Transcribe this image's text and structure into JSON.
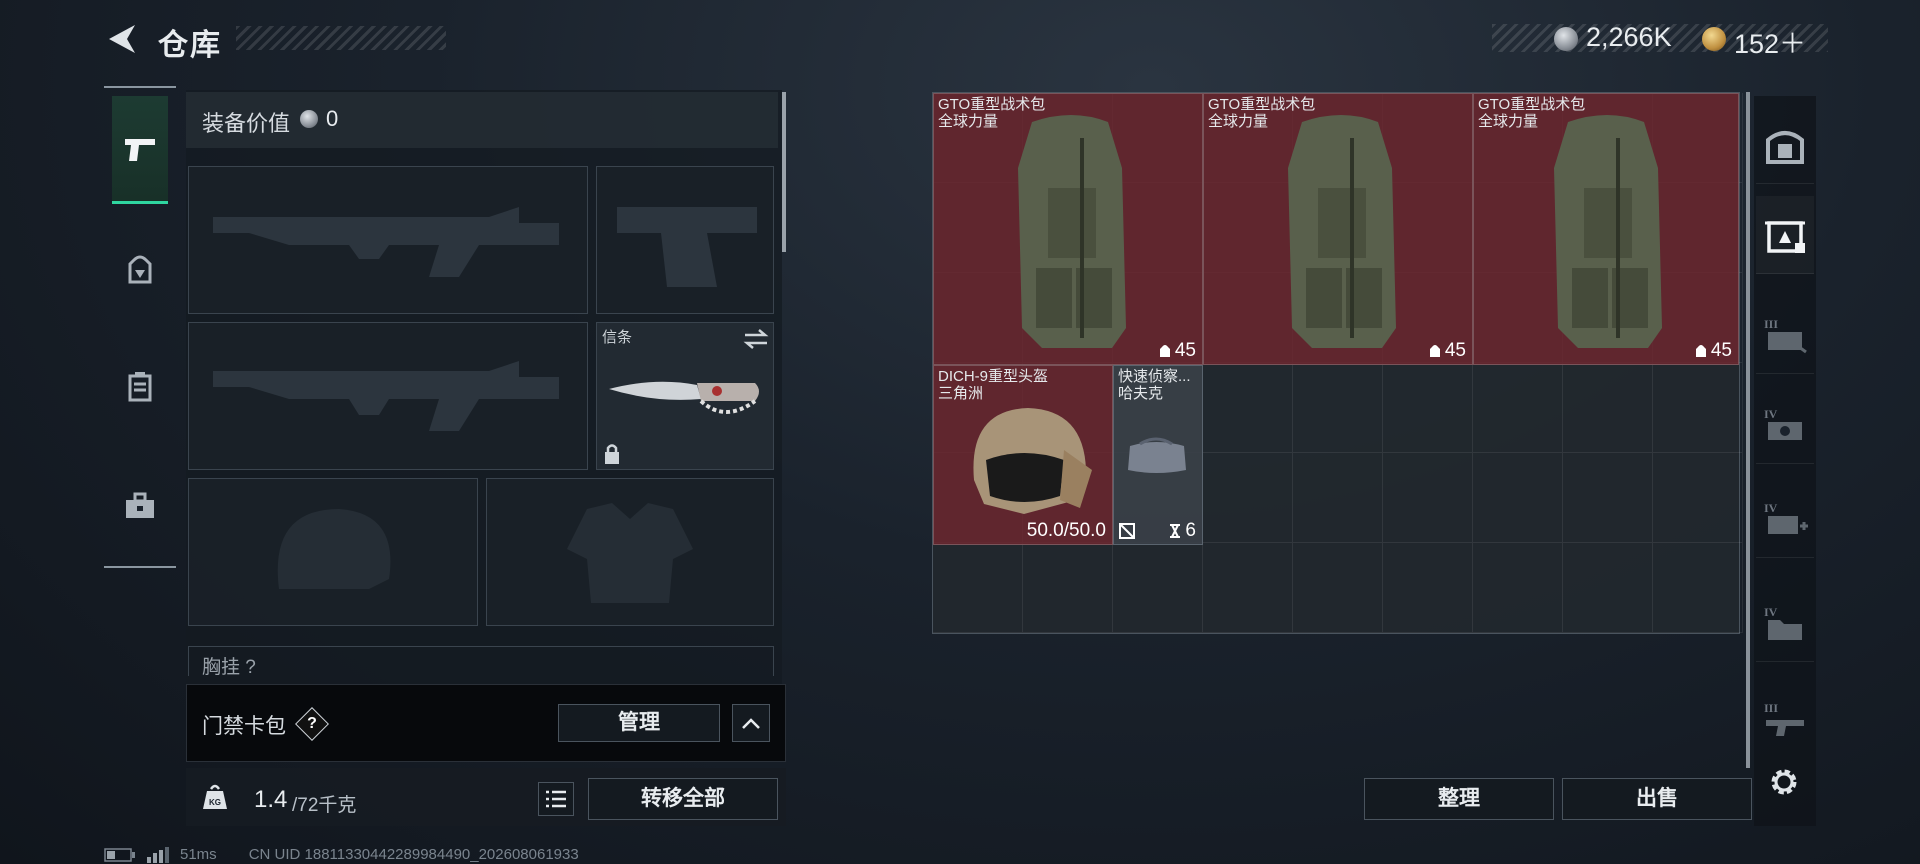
{
  "header": {
    "title": "仓库",
    "currency1": "2,266K",
    "currency2": "152＋"
  },
  "equipment": {
    "value_label": "装备价值",
    "value": "0",
    "melee_name": "信条",
    "chest_label": "胸挂 ?"
  },
  "cardpack": {
    "label": "门禁卡包",
    "help": "?",
    "manage": "管理"
  },
  "bottom": {
    "weight": "1.4",
    "weight_max": "/72千克",
    "transfer_all": "转移全部"
  },
  "status": {
    "ping": "51ms",
    "uid": "CN UID 18811330442289984490_202608061933"
  },
  "stash": {
    "items": [
      {
        "name": "GTO重型战术包",
        "sub": "全球力量",
        "count": "45"
      },
      {
        "name": "GTO重型战术包",
        "sub": "全球力量",
        "count": "45"
      },
      {
        "name": "GTO重型战术包",
        "sub": "全球力量",
        "count": "45"
      },
      {
        "name": "DICH-9重型头盔",
        "sub": "三角洲",
        "durability": "50.0/50.0"
      },
      {
        "name": "快速侦察...",
        "sub": "哈夫克",
        "count": "6"
      }
    ],
    "sort": "整理",
    "sell": "出售"
  },
  "right_tabs": [
    {
      "icon": "safe-box-icon",
      "label": ""
    },
    {
      "icon": "container-lock-icon",
      "label": ""
    },
    {
      "icon": "tier-iii-container-icon",
      "label": "III"
    },
    {
      "icon": "tier-iv-container-icon",
      "label": "IV"
    },
    {
      "icon": "tier-iv-add-icon",
      "label": "IV"
    },
    {
      "icon": "tier-iv-folder-icon",
      "label": "IV"
    },
    {
      "icon": "tier-iii-gun-icon",
      "label": "III"
    }
  ],
  "colors": {
    "accent": "#2fd6a0",
    "item_bg": "#6e262e"
  }
}
